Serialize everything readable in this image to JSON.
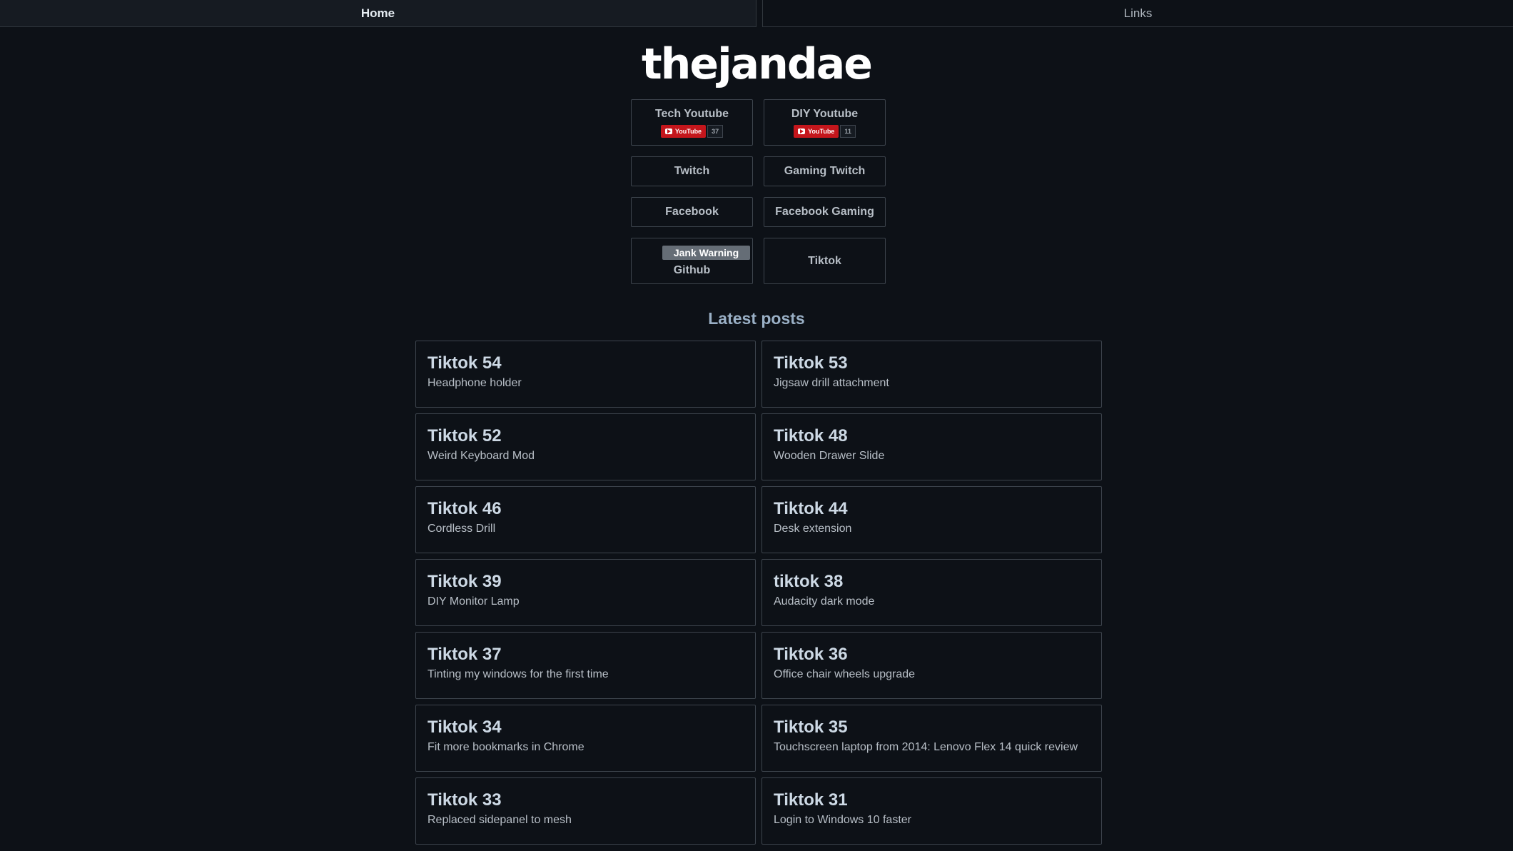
{
  "nav": {
    "home": "Home",
    "links": "Links"
  },
  "logo": "thejandae",
  "links": {
    "tech_youtube": {
      "label": "Tech Youtube",
      "badge": "YouTube",
      "count": "37"
    },
    "diy_youtube": {
      "label": "DIY Youtube",
      "badge": "YouTube",
      "count": "11"
    },
    "twitch": "Twitch",
    "gaming_twitch": "Gaming Twitch",
    "facebook": "Facebook",
    "facebook_gaming": "Facebook Gaming",
    "github": {
      "warning": "Jank Warning",
      "label": "Github"
    },
    "tiktok": "Tiktok"
  },
  "latest_posts": {
    "title": "Latest posts",
    "posts": [
      {
        "title": "Tiktok 54",
        "desc": "Headphone holder"
      },
      {
        "title": "Tiktok 53",
        "desc": "Jigsaw drill attachment"
      },
      {
        "title": "Tiktok 52",
        "desc": "Weird Keyboard Mod"
      },
      {
        "title": "Tiktok 48",
        "desc": "Wooden Drawer Slide"
      },
      {
        "title": "Tiktok 46",
        "desc": "Cordless Drill"
      },
      {
        "title": "Tiktok 44",
        "desc": "Desk extension"
      },
      {
        "title": "Tiktok 39",
        "desc": "DIY Monitor Lamp"
      },
      {
        "title": "tiktok 38",
        "desc": "Audacity dark mode"
      },
      {
        "title": "Tiktok 37",
        "desc": "Tinting my windows for the first time"
      },
      {
        "title": "Tiktok 36",
        "desc": "Office chair wheels upgrade"
      },
      {
        "title": "Tiktok 34",
        "desc": "Fit more bookmarks in Chrome"
      },
      {
        "title": "Tiktok 35",
        "desc": "Touchscreen laptop from 2014: Lenovo Flex 14 quick review"
      },
      {
        "title": "Tiktok 33",
        "desc": "Replaced sidepanel to mesh"
      },
      {
        "title": "Tiktok 31",
        "desc": "Login to Windows 10 faster"
      }
    ]
  }
}
